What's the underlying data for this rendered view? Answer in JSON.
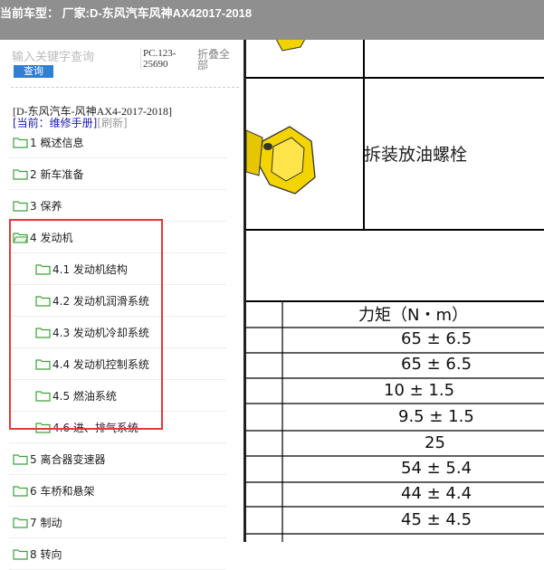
{
  "window": {
    "title": "当前车型：  厂家:D-东风汽车风神AX42017-2018"
  },
  "search": {
    "placeholder": "输入关键字查询",
    "button": "查询",
    "code": "PC.123-25690",
    "collapse_all": "折叠全部"
  },
  "book": {
    "name": "[D-东风汽车-风神AX4-2017-2018]",
    "current_label": "[当前：维修手册]",
    "refresh": "[刷新]"
  },
  "tree": [
    {
      "label": "1 概述信息",
      "level": 0
    },
    {
      "label": "2 新车准备",
      "level": 0
    },
    {
      "label": "3 保养",
      "level": 0
    },
    {
      "label": "4 发动机",
      "level": 0,
      "expanded": true
    },
    {
      "label": "4.1 发动机结构",
      "level": 1
    },
    {
      "label": "4.2 发动机润滑系统",
      "level": 1
    },
    {
      "label": "4.3 发动机冷却系统",
      "level": 1
    },
    {
      "label": "4.4 发动机控制系统",
      "level": 1
    },
    {
      "label": "4.5 燃油系统",
      "level": 1
    },
    {
      "label": "4.6 进、排气系统",
      "level": 1
    },
    {
      "label": "5 离合器变速器",
      "level": 0
    },
    {
      "label": "6 车桥和悬架",
      "level": 0
    },
    {
      "label": "7 制动",
      "level": 0
    },
    {
      "label": "8 转向",
      "level": 0
    }
  ],
  "document": {
    "drain_plug_label": "拆装放油螺栓",
    "torque_header": "力矩（N・m）",
    "torque_values": [
      "65 ± 6.5",
      "65 ± 6.5",
      "10 ± 1.5",
      "9.5 ± 1.5",
      "25",
      "54 ± 5.4",
      "44 ± 4.4",
      "45 ± 4.5"
    ]
  },
  "colors": {
    "title_bar": "#8f8f8f",
    "search_button": "#2f7fd2",
    "folder": "#3aa23a",
    "highlight_border": "#e23b3b",
    "bolt": "#f2d200"
  }
}
